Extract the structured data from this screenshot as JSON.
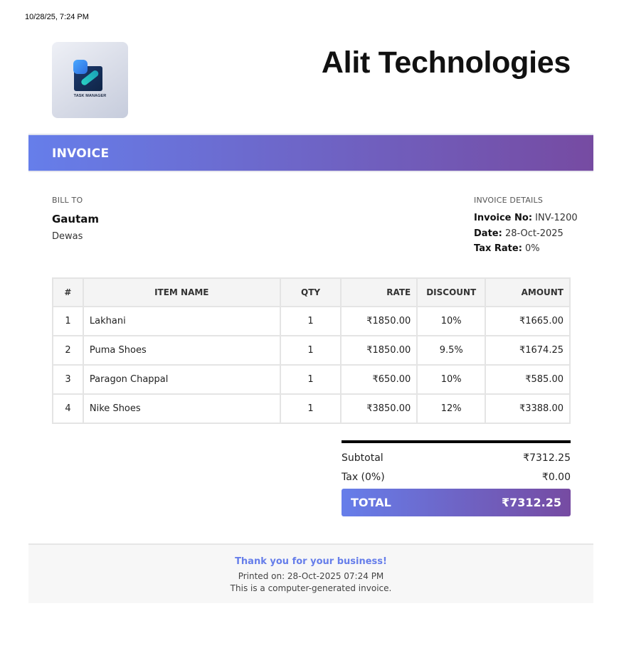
{
  "print_stamp": "10/28/25, 7:24 PM",
  "logo": {
    "icon": "task-manager-logo",
    "text": "TASK MANAGER"
  },
  "company_name": "Alit Technologies",
  "banner": {
    "title": "INVOICE"
  },
  "bill_to": {
    "heading": "BILL TO",
    "name": "Gautam",
    "city": "Dewas"
  },
  "invoice_details": {
    "heading": "INVOICE DETAILS",
    "invoice_no_label": "Invoice No:",
    "invoice_no": "INV-1200",
    "date_label": "Date:",
    "date": "28-Oct-2025",
    "tax_rate_label": "Tax Rate:",
    "tax_rate": "0%"
  },
  "table": {
    "headers": [
      "#",
      "ITEM NAME",
      "QTY",
      "RATE",
      "DISCOUNT",
      "AMOUNT"
    ],
    "rows": [
      {
        "num": "1",
        "name": "Lakhani",
        "qty": "1",
        "rate": "₹1850.00",
        "discount": "10%",
        "amount": "₹1665.00"
      },
      {
        "num": "2",
        "name": "Puma Shoes",
        "qty": "1",
        "rate": "₹1850.00",
        "discount": "9.5%",
        "amount": "₹1674.25"
      },
      {
        "num": "3",
        "name": "Paragon Chappal",
        "qty": "1",
        "rate": "₹650.00",
        "discount": "10%",
        "amount": "₹585.00"
      },
      {
        "num": "4",
        "name": "Nike Shoes",
        "qty": "1",
        "rate": "₹3850.00",
        "discount": "12%",
        "amount": "₹3388.00"
      }
    ]
  },
  "totals": {
    "subtotal_label": "Subtotal",
    "subtotal": "₹7312.25",
    "tax_label": "Tax (0%)",
    "tax": "₹0.00",
    "total_label": "TOTAL",
    "total": "₹7312.25"
  },
  "footer": {
    "thanks": "Thank you for your business!",
    "printed_on": "Printed on: 28-Oct-2025 07:24 PM",
    "note": "This is a computer-generated invoice."
  },
  "colors": {
    "accent_start": "#667eea",
    "accent_end": "#764ba2"
  }
}
